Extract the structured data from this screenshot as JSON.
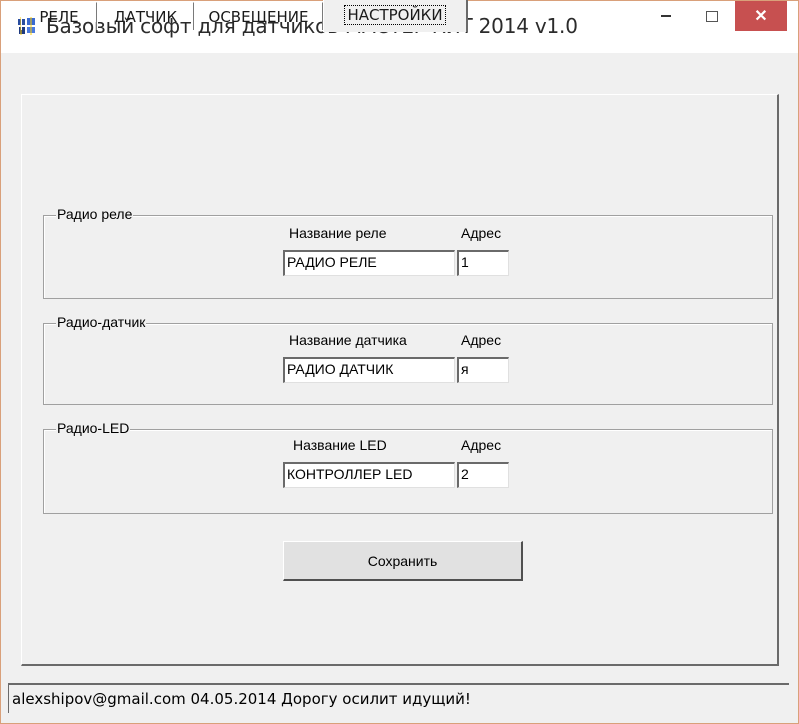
{
  "window": {
    "title": "Базовый софт для датчиков МАСТЕР КИТ 2014 v1.0",
    "close_glyph": "✕"
  },
  "tabs": [
    {
      "label": "РЕЛЕ",
      "active": false
    },
    {
      "label": "ДАТЧИК",
      "active": false
    },
    {
      "label": "ОСВЕЩЕНИЕ",
      "active": false
    },
    {
      "label": "НАСТРОЙКИ",
      "active": true
    }
  ],
  "groups": {
    "relay": {
      "title": "Радио  реле",
      "name_label": "Название реле",
      "addr_label": "Адрес",
      "name_value": "РАДИО РЕЛЕ",
      "addr_value": "1"
    },
    "sensor": {
      "title": "Радио-датчик",
      "name_label": "Название датчика",
      "addr_label": "Адрес",
      "name_value": "РАДИО ДАТЧИК",
      "addr_value": "я"
    },
    "led": {
      "title": "Радио-LED",
      "name_label": "Название LED",
      "addr_label": "Адрес",
      "name_value": "КОНТРОЛЛЕР LED",
      "addr_value": "2"
    }
  },
  "save_button": "Сохранить",
  "status_bar": "alexshipov@gmail.com  04.05.2014   Дорогу осилит идущий!",
  "colors": {
    "close_button": "#c75050",
    "window_bg": "#f0f0f0",
    "title_icon": "#2a4ea0"
  },
  "icons": {
    "app": "app-icon",
    "minimize": "minimize-icon",
    "maximize": "maximize-icon",
    "close": "close-icon"
  }
}
